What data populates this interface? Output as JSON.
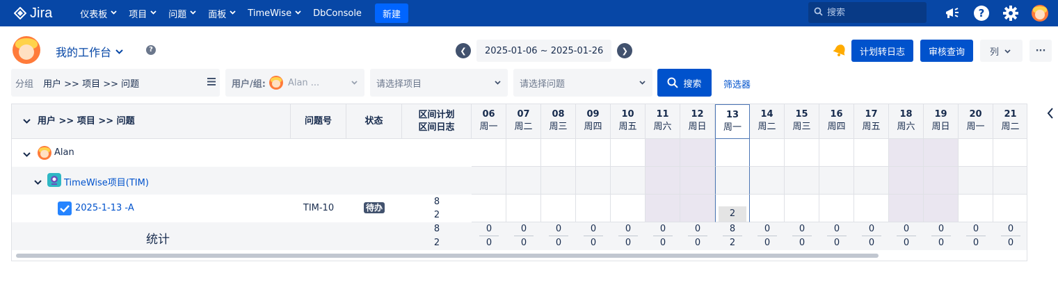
{
  "nav": {
    "logo_text": "Jira",
    "items": [
      {
        "label": "仪表板",
        "has_caret": true
      },
      {
        "label": "项目",
        "has_caret": true
      },
      {
        "label": "问题",
        "has_caret": true
      },
      {
        "label": "面板",
        "has_caret": true
      },
      {
        "label": "TimeWise",
        "has_caret": true
      },
      {
        "label": "DbConsole",
        "has_caret": false
      }
    ],
    "create_label": "新建",
    "search_placeholder": "搜索",
    "icons": [
      "megaphone-icon",
      "help-icon",
      "gear-icon",
      "avatar"
    ]
  },
  "toolbar": {
    "workspace_label": "我的工作台",
    "help_glyph": "?",
    "prev_glyph": "❮",
    "next_glyph": "❯",
    "date_range": "2025-01-06 ~ 2025-01-26",
    "plan_to_log_label": "计划转日志",
    "audit_query_label": "审核查询",
    "columns_label": "列",
    "more_label": "···"
  },
  "filters": {
    "group_label": "分组",
    "group_value": "用户 >> 项目 >> 问题",
    "user_label": "用户/组:",
    "user_value": "Alan  ...",
    "project_placeholder": "请选择项目",
    "issue_placeholder": "请选择问题",
    "search_label": "搜索",
    "filter_link": "筛选器"
  },
  "table": {
    "header_tree": "用户 >> 项目 >> 问题",
    "header_issue_key": "问题号",
    "header_status": "状态",
    "header_plan": "区间计划",
    "header_log": "区间日志",
    "days": [
      {
        "num": "06",
        "wd": "周一",
        "weekend": false,
        "today": false
      },
      {
        "num": "07",
        "wd": "周二",
        "weekend": false,
        "today": false
      },
      {
        "num": "08",
        "wd": "周三",
        "weekend": false,
        "today": false
      },
      {
        "num": "09",
        "wd": "周四",
        "weekend": false,
        "today": false
      },
      {
        "num": "10",
        "wd": "周五",
        "weekend": false,
        "today": false
      },
      {
        "num": "11",
        "wd": "周六",
        "weekend": true,
        "today": false
      },
      {
        "num": "12",
        "wd": "周日",
        "weekend": true,
        "today": false
      },
      {
        "num": "13",
        "wd": "周一",
        "weekend": false,
        "today": true
      },
      {
        "num": "14",
        "wd": "周二",
        "weekend": false,
        "today": false
      },
      {
        "num": "15",
        "wd": "周三",
        "weekend": false,
        "today": false
      },
      {
        "num": "16",
        "wd": "周四",
        "weekend": false,
        "today": false
      },
      {
        "num": "17",
        "wd": "周五",
        "weekend": false,
        "today": false
      },
      {
        "num": "18",
        "wd": "周六",
        "weekend": true,
        "today": false
      },
      {
        "num": "19",
        "wd": "周日",
        "weekend": true,
        "today": false
      },
      {
        "num": "20",
        "wd": "周一",
        "weekend": false,
        "today": false
      },
      {
        "num": "21",
        "wd": "周二",
        "weekend": false,
        "today": false
      }
    ],
    "user_row": {
      "name": "Alan"
    },
    "project_row": {
      "name": "TimeWise项目(TIM)"
    },
    "issue_row": {
      "summary": "2025-1-13 -A",
      "key": "TIM-10",
      "status": "待办",
      "plan": "8",
      "log": "2",
      "day_values": [
        "",
        "",
        "",
        "",
        "",
        "",
        "",
        "2",
        "",
        "",
        "",
        "",
        "",
        "",
        "",
        ""
      ]
    },
    "stats": {
      "label": "统计",
      "plan": "8",
      "log": "2",
      "day_plan": [
        "0",
        "0",
        "0",
        "0",
        "0",
        "0",
        "0",
        "8",
        "0",
        "0",
        "0",
        "0",
        "0",
        "0",
        "0",
        "0"
      ],
      "day_log": [
        "0",
        "0",
        "0",
        "0",
        "0",
        "0",
        "0",
        "2",
        "0",
        "0",
        "0",
        "0",
        "0",
        "0",
        "0",
        "0"
      ]
    }
  }
}
